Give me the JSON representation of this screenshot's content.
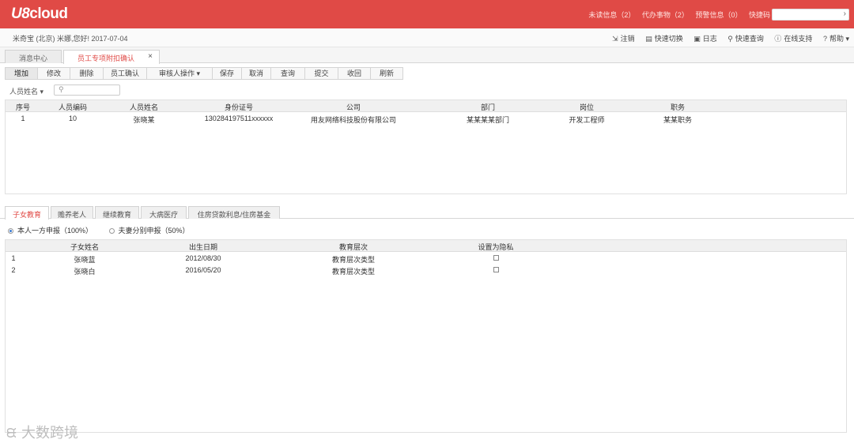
{
  "app": {
    "logo_main": "U8",
    "logo_sub": "cloud"
  },
  "header": {
    "links": [
      "未读信息（2）",
      "代办事物（2）",
      "预警信息（0）"
    ],
    "quick_label": "快捷码"
  },
  "user": {
    "greeting": "米奇宝 (北京) 米娜,您好! 2017-07-04",
    "tools": [
      {
        "icon": "logout-icon",
        "glyph": "⇲",
        "label": "注销"
      },
      {
        "icon": "switch-icon",
        "glyph": "▤",
        "label": "快速切换"
      },
      {
        "icon": "log-icon",
        "glyph": "▣",
        "label": "日志"
      },
      {
        "icon": "search-icon",
        "glyph": "⚲",
        "label": "快速查询"
      },
      {
        "icon": "support-icon",
        "glyph": "ⓘ",
        "label": "在线支持"
      },
      {
        "icon": "help-icon",
        "glyph": "?",
        "label": "帮助 ▾"
      }
    ]
  },
  "page_tabs": [
    {
      "label": "消息中心"
    },
    {
      "label": "员工专项附扣确认",
      "close": "×"
    }
  ],
  "toolbar": [
    "增加",
    "修改",
    "删除",
    "员工确认",
    "审核人操作 ▾",
    "保存",
    "取消",
    "查询",
    "提交",
    "收回",
    "刷新"
  ],
  "filter": {
    "label": "人员姓名 ▾",
    "search_glyph": "⚲"
  },
  "grid1": {
    "columns": [
      "序号",
      "人员编码",
      "人员姓名",
      "身份证号",
      "公司",
      "部门",
      "岗位",
      "职务"
    ],
    "rows": [
      [
        "1",
        "10",
        "张晓某",
        "130284197511xxxxxx",
        "用友网络科技股份有限公司",
        "某某某某部门",
        "开发工程师",
        "某某职务"
      ]
    ]
  },
  "sub_tabs": [
    "子女教育",
    "赡养老人",
    "继续教育",
    "大病医疗",
    "住房贷款利息/住房基金"
  ],
  "radios": [
    {
      "label": "本人一方申报（100%）",
      "checked": true
    },
    {
      "label": "夫妻分别申报（50%）",
      "checked": false
    }
  ],
  "grid2": {
    "columns": [
      "子女姓名",
      "出生日期",
      "教育层次",
      "设置为隐私"
    ],
    "rows": [
      {
        "index": "1",
        "name": "张晓蓝",
        "birth": "2012/08/30",
        "level": "教育层次类型"
      },
      {
        "index": "2",
        "name": "张晓白",
        "birth": "2016/05/20",
        "level": "教育层次类型"
      }
    ]
  },
  "watermark": {
    "glyph": "ᙙ",
    "text": "大数跨境"
  },
  "colors": {
    "brand": "#e04a46"
  }
}
